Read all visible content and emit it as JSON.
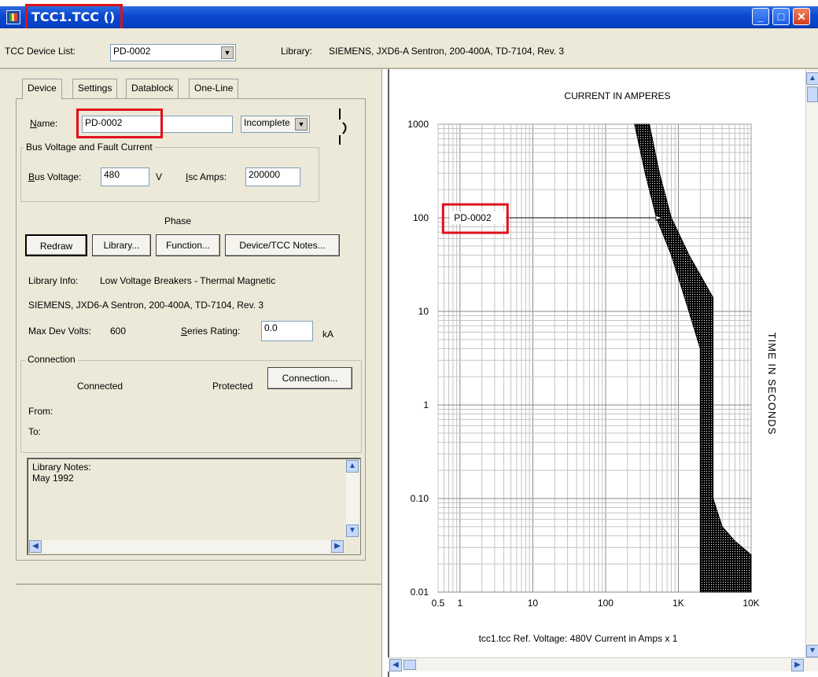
{
  "window": {
    "title": "TCC1.TCC ()"
  },
  "devbar": {
    "device_list_label": "TCC Device List:",
    "device_list_value": "PD-0002",
    "library_label": "Library:",
    "library_value": "SIEMENS, JXD6-A Sentron, 200-400A, TD-7104, Rev. 3"
  },
  "tabs": [
    {
      "label": "Device"
    },
    {
      "label": "Settings"
    },
    {
      "label": "Datablock"
    },
    {
      "label": "One-Line"
    }
  ],
  "device": {
    "name_label": "Name:",
    "name_value": "PD-0002",
    "status_value": "Incomplete",
    "bus_group_title": "Bus Voltage and Fault Current",
    "bus_voltage_label": "Bus Voltage:",
    "bus_voltage_value": "480",
    "bus_voltage_unit": "V",
    "isc_label": "Isc Amps:",
    "isc_value": "200000",
    "phase_label": "Phase",
    "buttons": {
      "redraw": "Redraw",
      "library": "Library...",
      "function": "Function...",
      "notes": "Device/TCC Notes..."
    },
    "library_info_label": "Library Info:",
    "library_info_value": "Low Voltage Breakers - Thermal Magnetic",
    "library_info_line2": "SIEMENS, JXD6-A Sentron, 200-400A, TD-7104, Rev. 3",
    "max_dev_volts_label": "Max Dev Volts:",
    "max_dev_volts_value": "600",
    "series_rating_label": "Series Rating:",
    "series_rating_value": "0.0",
    "series_rating_unit": "kA",
    "connection": {
      "title": "Connection",
      "connected": "Connected",
      "protected": "Protected",
      "button": "Connection...",
      "from_label": "From:",
      "to_label": "To:"
    },
    "library_notes": "Library Notes:\nMay 1992"
  },
  "chart_data": {
    "type": "line",
    "title": "CURRENT IN AMPERES",
    "ylabel": "TIME IN SECONDS",
    "xscale": "log",
    "yscale": "log",
    "xlim": [
      0.5,
      10000
    ],
    "ylim": [
      0.01,
      1000
    ],
    "x_ticks": [
      "0.5",
      "1",
      "10",
      "100",
      "1K",
      "10K"
    ],
    "y_ticks": [
      "1000",
      "100",
      "10",
      "1",
      "0.10",
      "0.01"
    ],
    "series": [
      {
        "name": "PD-0002",
        "band_left": [
          [
            250,
            1000
          ],
          [
            350,
            300
          ],
          [
            500,
            100
          ],
          [
            800,
            40
          ],
          [
            1300,
            12
          ],
          [
            2000,
            4
          ],
          [
            2000,
            0.01
          ]
        ],
        "band_right": [
          [
            400,
            1000
          ],
          [
            550,
            300
          ],
          [
            800,
            100
          ],
          [
            1400,
            40
          ],
          [
            2500,
            18
          ],
          [
            3000,
            14
          ],
          [
            3000,
            0.1
          ],
          [
            4000,
            0.05
          ],
          [
            6000,
            0.035
          ],
          [
            10000,
            0.025
          ],
          [
            10000,
            0.01
          ]
        ]
      }
    ],
    "label_arrow_point": [
      600,
      100
    ],
    "footer": "tcc1.tcc   Ref. Voltage: 480V   Current in Amps x 1",
    "grid": true
  }
}
